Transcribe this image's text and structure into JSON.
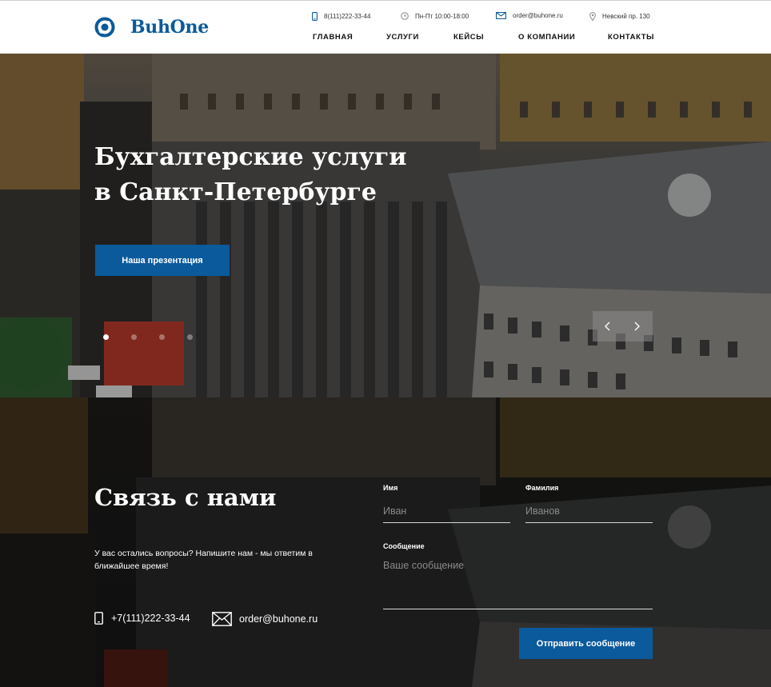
{
  "brand": {
    "name": "BuhOne",
    "accent": "#0b5a9c"
  },
  "header": {
    "phone": "8(111)222-33-44",
    "hours": "Пн-Пт 10:00-18:00",
    "email": "order@buhone.ru",
    "address": "Невский пр. 130",
    "nav": [
      "ГЛАВНАЯ",
      "УСЛУГИ",
      "КЕЙСЫ",
      "О КОМПАНИИ",
      "КОНТАКТЫ"
    ]
  },
  "icons": {
    "phone": "phone-icon",
    "clock": "clock-icon",
    "mail": "mail-icon",
    "location": "location-pin-icon",
    "prev": "chevron-left-icon",
    "next": "chevron-right-icon"
  },
  "hero": {
    "title_line1": "Бухгалтерские услуги",
    "title_line2": "в Санкт-Петербурге",
    "button": "Наша презентация",
    "slides_total": 4,
    "slide_active": 1
  },
  "contact": {
    "title": "Связь с нами",
    "text": "У вас остались вопросы? Напишите нам - мы ответим в ближайшее время!",
    "phone": "+7(111)222-33-44",
    "email": "order@buhone.ru",
    "form": {
      "first_name_label": "Имя",
      "first_name_placeholder": "Иван",
      "last_name_label": "Фамилия",
      "last_name_placeholder": "Иванов",
      "message_label": "Сообщение",
      "message_placeholder": "Ваше сообщение",
      "submit": "Отправить сообщение"
    }
  }
}
